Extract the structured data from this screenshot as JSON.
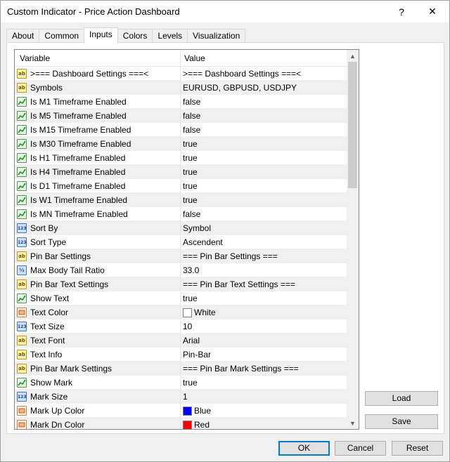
{
  "window": {
    "title": "Custom Indicator - Price Action Dashboard",
    "help_label": "?",
    "close_label": "✕"
  },
  "tabs": [
    {
      "label": "About"
    },
    {
      "label": "Common"
    },
    {
      "label": "Inputs",
      "active": true
    },
    {
      "label": "Colors"
    },
    {
      "label": "Levels"
    },
    {
      "label": "Visualization"
    }
  ],
  "grid": {
    "header": {
      "variable": "Variable",
      "value": "Value"
    },
    "rows": [
      {
        "icon": "string-icon",
        "variable": ">=== Dashboard Settings ===<",
        "value": ">=== Dashboard Settings ===<"
      },
      {
        "icon": "string-icon",
        "variable": "Symbols",
        "value": "EURUSD, GBPUSD, USDJPY"
      },
      {
        "icon": "bool-icon",
        "variable": "Is M1 Timeframe Enabled",
        "value": "false"
      },
      {
        "icon": "bool-icon",
        "variable": "Is M5 Timeframe Enabled",
        "value": "false"
      },
      {
        "icon": "bool-icon",
        "variable": "Is M15 Timeframe Enabled",
        "value": "false"
      },
      {
        "icon": "bool-icon",
        "variable": "Is M30 Timeframe Enabled",
        "value": "true"
      },
      {
        "icon": "bool-icon",
        "variable": "Is H1 Timeframe Enabled",
        "value": "true"
      },
      {
        "icon": "bool-icon",
        "variable": "Is H4 Timeframe Enabled",
        "value": "true"
      },
      {
        "icon": "bool-icon",
        "variable": "Is D1 Timeframe Enabled",
        "value": "true"
      },
      {
        "icon": "bool-icon",
        "variable": "Is W1 Timeframe Enabled",
        "value": "true"
      },
      {
        "icon": "bool-icon",
        "variable": "Is MN Timeframe Enabled",
        "value": "false"
      },
      {
        "icon": "enum-icon",
        "variable": "Sort By",
        "value": "Symbol"
      },
      {
        "icon": "enum-icon",
        "variable": "Sort Type",
        "value": "Ascendent"
      },
      {
        "icon": "string-icon",
        "variable": "Pin Bar Settings",
        "value": " === Pin Bar Settings ==="
      },
      {
        "icon": "double-icon",
        "variable": "Max Body Tail Ratio",
        "value": "33.0"
      },
      {
        "icon": "string-icon",
        "variable": "Pin Bar Text Settings",
        "value": " === Pin Bar Text Settings ==="
      },
      {
        "icon": "bool-icon",
        "variable": "Show Text",
        "value": "true"
      },
      {
        "icon": "color-icon",
        "variable": "Text Color",
        "value": "White",
        "swatch": "#ffffff"
      },
      {
        "icon": "enum-icon",
        "variable": "Text Size",
        "value": "10"
      },
      {
        "icon": "string-icon",
        "variable": "Text Font",
        "value": "Arial"
      },
      {
        "icon": "string-icon",
        "variable": "Text Info",
        "value": "Pin-Bar"
      },
      {
        "icon": "string-icon",
        "variable": "Pin Bar Mark Settings",
        "value": " === Pin Bar Mark Settings ==="
      },
      {
        "icon": "bool-icon",
        "variable": "Show Mark",
        "value": "true"
      },
      {
        "icon": "enum-icon",
        "variable": "Mark Size",
        "value": "1"
      },
      {
        "icon": "color-icon",
        "variable": "Mark Up Color",
        "value": "Blue",
        "swatch": "#0000ff"
      },
      {
        "icon": "color-icon",
        "variable": "Mark Dn Color",
        "value": "Red",
        "swatch": "#ff0000"
      }
    ]
  },
  "side_buttons": {
    "load": "Load",
    "save": "Save"
  },
  "footer": {
    "ok": "OK",
    "cancel": "Cancel",
    "reset": "Reset"
  },
  "icon_glyphs": {
    "string": "ab",
    "enum": "123",
    "double": "½"
  }
}
